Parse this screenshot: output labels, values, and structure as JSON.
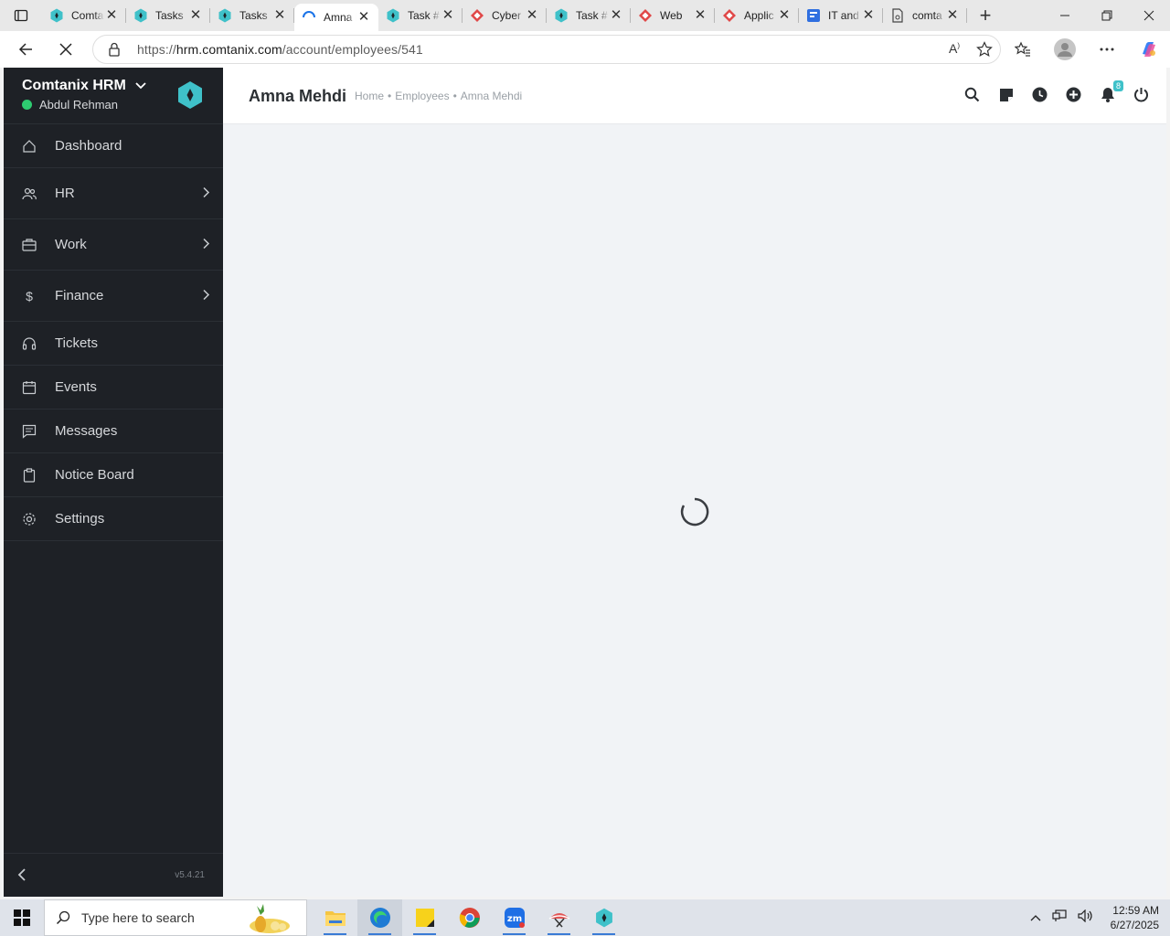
{
  "browser": {
    "tabs": [
      {
        "title": "Comtanix",
        "icon": "comtanix-favicon"
      },
      {
        "title": "Tasks",
        "icon": "comtanix-favicon"
      },
      {
        "title": "Tasks",
        "icon": "comtanix-favicon"
      },
      {
        "title": "Amna Mehdi",
        "icon": "loading-icon",
        "active": true
      },
      {
        "title": "Task #",
        "icon": "comtanix-favicon"
      },
      {
        "title": "Cyber",
        "icon": "web-favicon"
      },
      {
        "title": "Task #",
        "icon": "comtanix-favicon"
      },
      {
        "title": "Web",
        "icon": "web-favicon"
      },
      {
        "title": "Applic",
        "icon": "web-favicon"
      },
      {
        "title": "IT and",
        "icon": "forms-favicon"
      },
      {
        "title": "comta",
        "icon": "page-favicon"
      }
    ],
    "url_prefix": "https://",
    "url_host": "hrm.comtanix.com",
    "url_path": "/account/employees/541"
  },
  "sidebar": {
    "company": "Comtanix HRM",
    "user": "Abdul Rehman",
    "items": [
      {
        "label": "Dashboard",
        "icon": "home-icon"
      },
      {
        "label": "HR",
        "icon": "users-icon",
        "has_children": true
      },
      {
        "label": "Work",
        "icon": "briefcase-icon",
        "has_children": true
      },
      {
        "label": "Finance",
        "icon": "dollar-icon",
        "has_children": true
      },
      {
        "label": "Tickets",
        "icon": "headset-icon"
      },
      {
        "label": "Events",
        "icon": "calendar-icon"
      },
      {
        "label": "Messages",
        "icon": "message-icon"
      },
      {
        "label": "Notice Board",
        "icon": "clipboard-icon"
      },
      {
        "label": "Settings",
        "icon": "gear-icon"
      }
    ],
    "version": "v5.4.21"
  },
  "header": {
    "title": "Amna Mehdi",
    "breadcrumb": [
      "Home",
      "Employees",
      "Amna Mehdi"
    ],
    "notification_count": "8"
  },
  "taskbar": {
    "search_placeholder": "Type here to search",
    "time": "12:59 AM",
    "date": "6/27/2025"
  },
  "colors": {
    "sidebar_bg": "#1e2126",
    "accent": "#3fc1c9",
    "online": "#2ecc71"
  }
}
